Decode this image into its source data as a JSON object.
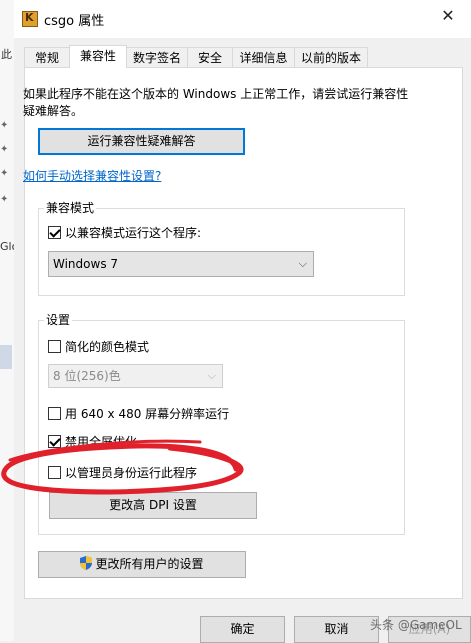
{
  "window": {
    "title": "csgo 属性",
    "icon_letter": "K"
  },
  "bg_window": {
    "labels": [
      "此",
      "Glo"
    ]
  },
  "tabs": [
    {
      "label": "常规"
    },
    {
      "label": "兼容性"
    },
    {
      "label": "数字签名"
    },
    {
      "label": "安全"
    },
    {
      "label": "详细信息"
    },
    {
      "label": "以前的版本"
    }
  ],
  "intro_text": "如果此程序不能在这个版本的 Windows 上正常工作，请尝试运行兼容性疑难解答。",
  "troubleshoot_button": "运行兼容性疑难解答",
  "manual_link": "如何手动选择兼容性设置?",
  "compat_mode": {
    "label": "兼容模式",
    "checkbox_label": "以兼容模式运行这个程序:",
    "checked": true,
    "selected_os": "Windows 7"
  },
  "settings": {
    "label": "设置",
    "reduced_color": {
      "label": "简化的颜色模式",
      "checked": false
    },
    "color_select": "8 位(256)色",
    "res_640": {
      "label": "用 640 x 480 屏幕分辨率运行",
      "checked": false
    },
    "disable_fullscreen": {
      "label": "禁用全屏优化",
      "checked": true
    },
    "run_as_admin": {
      "label": "以管理员身份运行此程序",
      "checked": false
    },
    "dpi_button": "更改高 DPI 设置"
  },
  "all_users_button": "更改所有用户的设置",
  "footer": {
    "ok": "确定",
    "cancel": "取消",
    "apply": "应用(A)"
  },
  "watermark": "头条 @GameOL",
  "colors": {
    "link": "#0066cc",
    "annotation": "#e0202a",
    "accent": "#0078d7"
  }
}
